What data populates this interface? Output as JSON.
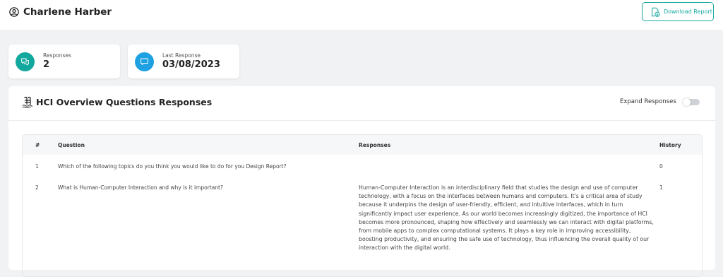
{
  "header": {
    "user_name": "Charlene Harber",
    "download_label": "Download Report"
  },
  "stats": [
    {
      "label": "Responses",
      "value": "2",
      "color": "#13a89e",
      "icon": "chat-bubbles-icon"
    },
    {
      "label": "Last Response",
      "value": "03/08/2023",
      "color": "#1da1e2",
      "icon": "message-icon"
    }
  ],
  "panel": {
    "title": "HCI Overview Questions Responses",
    "expand_label": "Expand Responses",
    "expand_on": false
  },
  "table": {
    "columns": [
      "#",
      "Question",
      "Responses",
      "History"
    ],
    "rows": [
      {
        "num": "1",
        "question": "Which of the following topics do you think you would like to do for you Design Report?",
        "response": "",
        "history": "0"
      },
      {
        "num": "2",
        "question": "What is Human-Computer Interaction and why is it important?",
        "response": "Human-Computer Interaction is an interdisciplinary field that studies the design and use of computer technology, with a focus on the interfaces between humans and computers. It's a critical area of study because it underpins the design of user-friendly, efficient, and intuitive interfaces, which in turn significantly impact user experience. As our world becomes increasingly digitized, the importance of HCI becomes more pronounced, shaping how effectively and seamlessly we can interact with digital platforms, from mobile apps to complex computational systems. It plays a key role in improving accessibility, boosting productivity, and ensuring the safe use of technology, thus influencing the overall quality of our interaction with the digital world.",
        "history": "1"
      }
    ]
  },
  "colors": {
    "accent": "#17a8a0",
    "background": "#f1f2f4"
  }
}
